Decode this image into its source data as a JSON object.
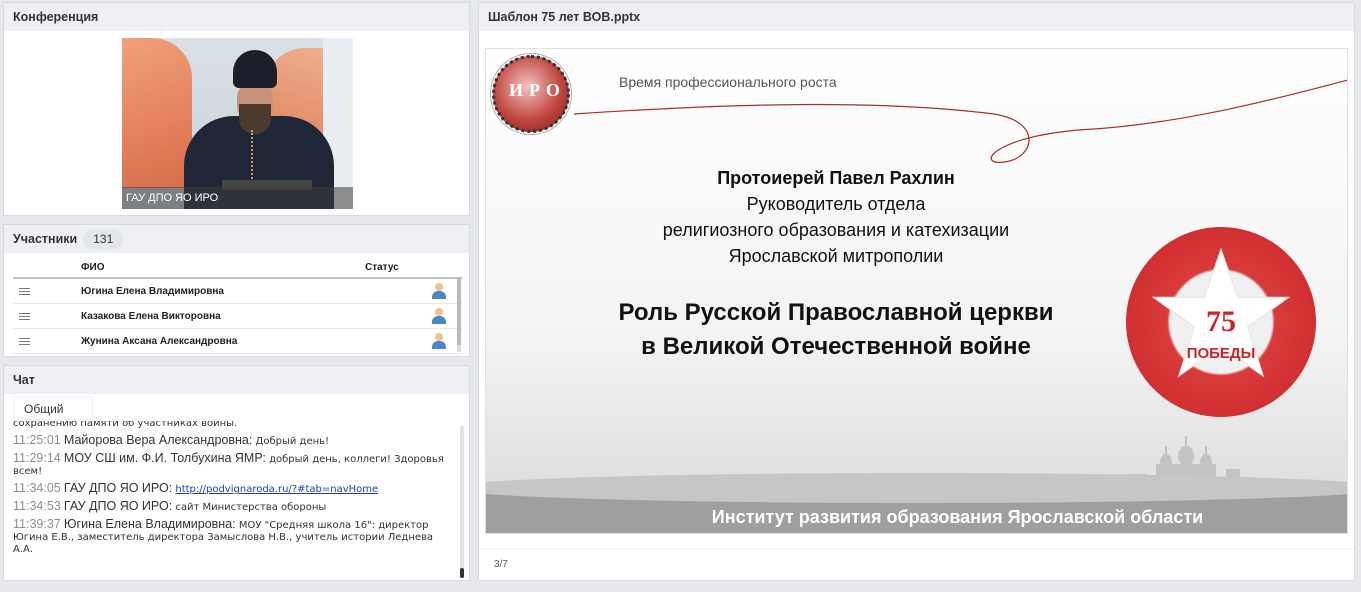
{
  "conference": {
    "title": "Конференция",
    "video_caption": "ГАУ ДПО ЯО ИРО"
  },
  "participants": {
    "title": "Участники",
    "count": "131",
    "columns": {
      "name": "ФИО",
      "status": "Статус"
    },
    "rows": [
      {
        "name": "Югина Елена  Владимировна"
      },
      {
        "name": "Казакова Елена Викторовна"
      },
      {
        "name": "Жунина Аксана Александровна"
      }
    ]
  },
  "chat": {
    "title": "Чат",
    "tab_general": "Общий",
    "partial_line": "сохранению памяти об участниках войны.",
    "messages": [
      {
        "time": "11:25:01",
        "author": "Майорова Вера Александровна:",
        "text": "Добрый день!"
      },
      {
        "time": "11:29:14",
        "author": "МОУ СШ им. Ф.И. Толбухина ЯМР:",
        "text": "добрый день, коллеги! Здоровья всем!"
      },
      {
        "time": "11:34:05",
        "author": "ГАУ ДПО ЯО ИРО:",
        "link": "http://podvignaroda.ru/?#tab=navHome"
      },
      {
        "time": "11:34:53",
        "author": "ГАУ ДПО ЯО ИРО:",
        "text": "сайт Министерства обороны"
      },
      {
        "time": "11:39:37",
        "author": "Югина Елена  Владимировна:",
        "text": "МОУ \"Средняя школа  16\": директор Югина Е.В., заместитель директора Замыслова Н.В., учитель истории Леднева А.А."
      }
    ]
  },
  "presentation": {
    "title": "Шаблон 75 лет ВОВ.pptx",
    "pager": "3/7",
    "slide": {
      "logo_text": "ИРО",
      "tagline": "Время профессионального роста",
      "speaker_name": "Протоиерей Павел Рахлин",
      "speaker_role_1": "Руководитель отдела",
      "speaker_role_2": "религиозного образования и катехизации",
      "speaker_role_3": "Ярославской митрополии",
      "topic_1": "Роль Русской Православной церкви",
      "topic_2": "в Великой Отечественной войне",
      "medal_number": "75",
      "medal_label": "ПОБЕДЫ",
      "footer": "Институт развития образования Ярославской области"
    }
  },
  "colors": {
    "panel_header_bg": "#eef0f3",
    "link": "#1a3fbf",
    "medal_red": "#c8262a",
    "footer_band": "#9f9f9f"
  }
}
